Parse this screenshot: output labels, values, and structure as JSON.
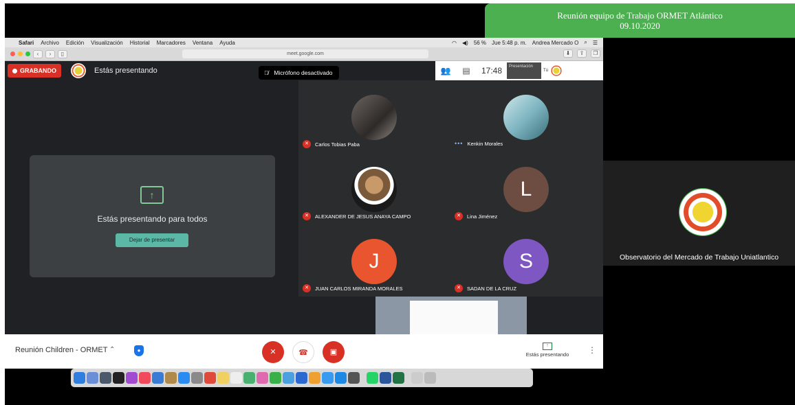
{
  "banner": {
    "title": "Reunión equipo de Trabajo ORMET Atlántico",
    "date": "09.10.2020"
  },
  "menubar": {
    "app": "Safari",
    "items": [
      "Archivo",
      "Edición",
      "Visualización",
      "Historial",
      "Marcadores",
      "Ventana",
      "Ayuda"
    ],
    "battery": "56 %",
    "datetime": "Jue 5:48 p. m.",
    "user": "Andrea Mercado O"
  },
  "safari": {
    "url": "meet.google.com"
  },
  "meet": {
    "recording_label": "GRABANDO",
    "presenting_label": "Estás presentando",
    "mic_toast": "Micrófono desactivado",
    "time": "17:48",
    "presentation_thumb": "Presentación",
    "you_label": "Tú",
    "share_card": {
      "text": "Estás presentando para todos",
      "stop_button": "Dejar de presentar"
    },
    "participants": [
      {
        "name": "Carlos Tobias Paba",
        "avatar": "photo",
        "status": "muted"
      },
      {
        "name": "Kenkin Morales",
        "avatar": "photo",
        "status": "speaking"
      },
      {
        "name": "ALEXANDER DE JESUS ANAYA CAMPO",
        "avatar": "photo",
        "status": "muted"
      },
      {
        "name": "Lina Jiménez",
        "avatar": "L",
        "color": "#6d4c41",
        "status": "muted"
      },
      {
        "name": "JUAN CARLOS MIRANDA MORALES",
        "avatar": "J",
        "color": "#e8552f",
        "status": "muted"
      },
      {
        "name": "SADAN DE LA CRUZ",
        "avatar": "S",
        "color": "#7e57c2",
        "status": "muted"
      }
    ],
    "bottom": {
      "meeting_name": "Reunión Children - ORMET",
      "present_label": "Estás presentando"
    }
  },
  "side_panel": {
    "org_name": "Observatorio del Mercado de Trabajo Uniatlantico"
  },
  "colors": {
    "record": "#d93025",
    "accent_green": "#4caf50",
    "meet_bg": "#202124"
  }
}
